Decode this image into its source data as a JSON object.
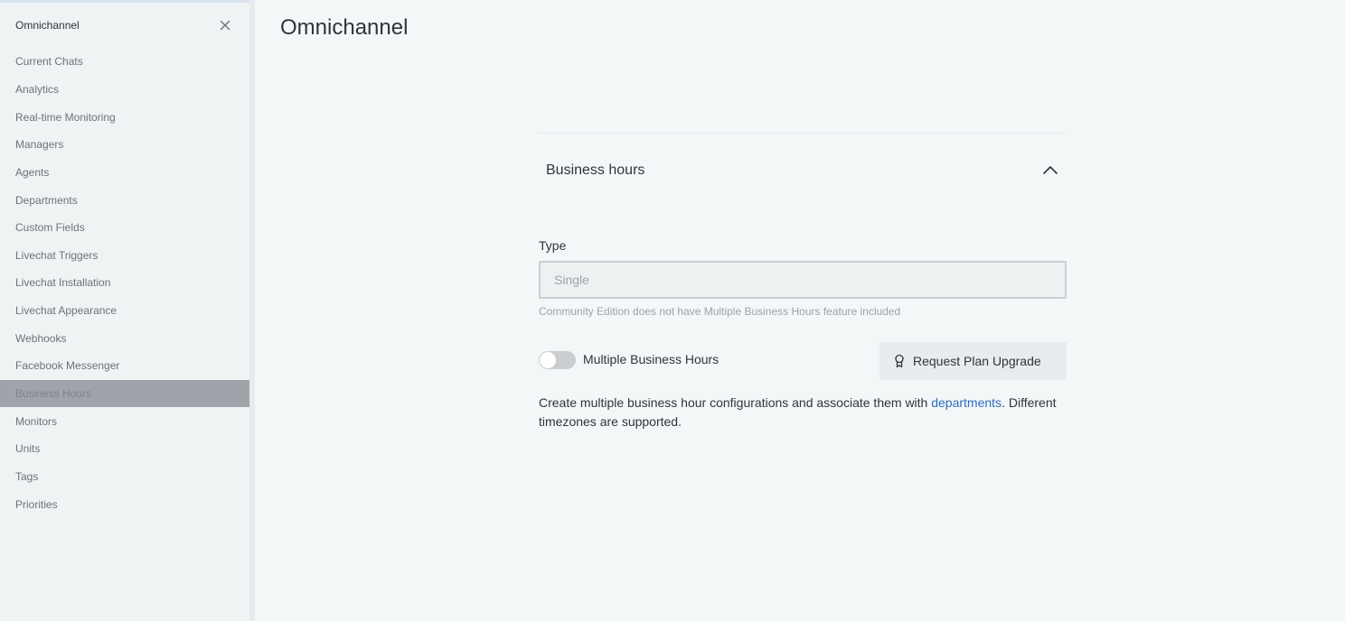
{
  "sidebar": {
    "title": "Omnichannel",
    "items": [
      {
        "label": "Current Chats",
        "active": false
      },
      {
        "label": "Analytics",
        "active": false
      },
      {
        "label": "Real-time Monitoring",
        "active": false
      },
      {
        "label": "Managers",
        "active": false
      },
      {
        "label": "Agents",
        "active": false
      },
      {
        "label": "Departments",
        "active": false
      },
      {
        "label": "Custom Fields",
        "active": false
      },
      {
        "label": "Livechat Triggers",
        "active": false
      },
      {
        "label": "Livechat Installation",
        "active": false
      },
      {
        "label": "Livechat Appearance",
        "active": false
      },
      {
        "label": "Webhooks",
        "active": false
      },
      {
        "label": "Facebook Messenger",
        "active": false
      },
      {
        "label": "Business Hours",
        "active": true
      },
      {
        "label": "Monitors",
        "active": false
      },
      {
        "label": "Units",
        "active": false
      },
      {
        "label": "Tags",
        "active": false
      },
      {
        "label": "Priorities",
        "active": false
      }
    ]
  },
  "main": {
    "title": "Omnichannel",
    "section": {
      "title": "Business hours",
      "expanded": true,
      "type_label": "Type",
      "type_value": "Single",
      "type_hint": "Community Edition does not have Multiple Business Hours feature included",
      "toggle_label": "Multiple Business Hours",
      "toggle_on": false,
      "upgrade_button": "Request Plan Upgrade",
      "description_before": "Create multiple business hour configurations and associate them with ",
      "description_link": "departments",
      "description_after": ". Different timezones are supported."
    }
  },
  "colors": {
    "sidebar_active": "#a0a4aa",
    "link": "#2d6cc0"
  }
}
